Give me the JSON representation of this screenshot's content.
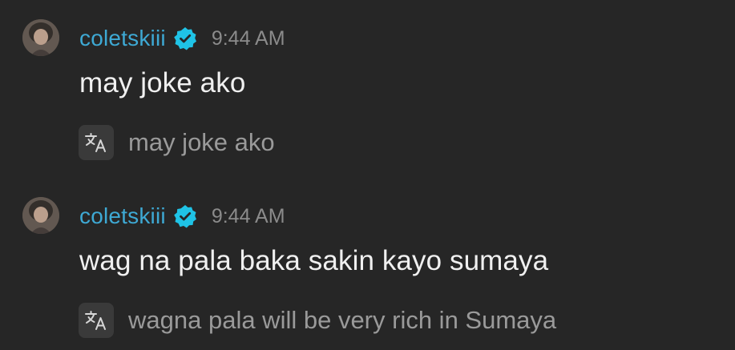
{
  "messages": [
    {
      "username": "coletskiii",
      "verified_icon": "verified-badge-icon",
      "timestamp": "9:44 AM",
      "text": "may joke ako",
      "translation_icon": "translate-icon",
      "translation": "may joke ako"
    },
    {
      "username": "coletskiii",
      "verified_icon": "verified-badge-icon",
      "timestamp": "9:44 AM",
      "text": "wag na pala baka sakin kayo sumaya",
      "translation_icon": "translate-icon",
      "translation": "wagna pala will be very rich in Sumaya"
    }
  ],
  "colors": {
    "background": "#262626",
    "username": "#3ea9d4",
    "verified_badge": "#1fc3e6",
    "timestamp": "#8b8b8b",
    "message_text": "#f0f0f0",
    "translation_text": "#9a9a9a",
    "translate_button": "#3a3a3a"
  }
}
